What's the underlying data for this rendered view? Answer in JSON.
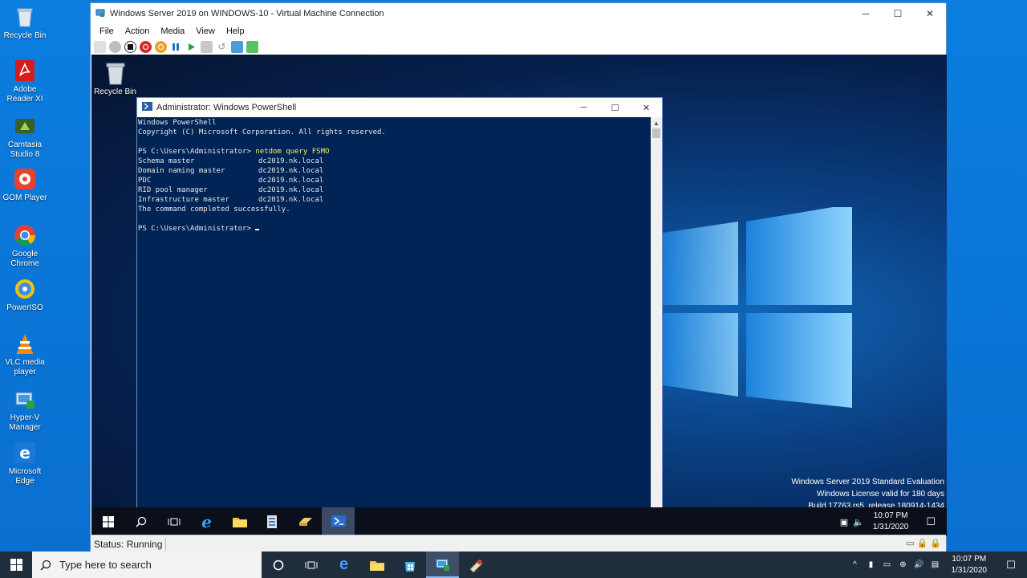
{
  "host_desktop": {
    "icons": [
      {
        "label": "Recycle Bin",
        "icon": "recycle-bin-icon"
      },
      {
        "label": "Adobe Reader XI",
        "icon": "adobe-reader-icon"
      },
      {
        "label": "Camtasia Studio 8",
        "icon": "camtasia-icon"
      },
      {
        "label": "GOM Player",
        "icon": "gom-player-icon"
      },
      {
        "label": "Google Chrome",
        "icon": "chrome-icon"
      },
      {
        "label": "PowerISO",
        "icon": "poweriso-icon"
      },
      {
        "label": "VLC media player",
        "icon": "vlc-icon"
      },
      {
        "label": "Hyper-V Manager",
        "icon": "hyper-v-icon"
      },
      {
        "label": "Microsoft Edge",
        "icon": "edge-icon"
      }
    ]
  },
  "vm_window": {
    "title": "Windows Server 2019 on WINDOWS-10 - Virtual Machine Connection",
    "menu": [
      "File",
      "Action",
      "Media",
      "View",
      "Help"
    ],
    "status": "Status: Running"
  },
  "guest": {
    "recycle_bin_label": "Recycle Bin",
    "watermark": {
      "line1": "Windows Server 2019 Standard Evaluation",
      "line2": "Windows License valid for 180 days",
      "line3": "Build 17763.rs5_release.180914-1434"
    },
    "clock": {
      "time": "10:07 PM",
      "date": "1/31/2020"
    }
  },
  "powershell": {
    "title": "Administrator: Windows PowerShell",
    "lines": {
      "header1": "Windows PowerShell",
      "header2": "Copyright (C) Microsoft Corporation. All rights reserved.",
      "prompt": "PS C:\\Users\\Administrator> ",
      "command": "netdom query FSMO",
      "roles": [
        {
          "role": "Schema master",
          "server": "dc2019.nk.local"
        },
        {
          "role": "Domain naming master",
          "server": "dc2019.nk.local"
        },
        {
          "role": "PDC",
          "server": "dc2019.nk.local"
        },
        {
          "role": "RID pool manager",
          "server": "dc2019.nk.local"
        },
        {
          "role": "Infrastructure master",
          "server": "dc2019.nk.local"
        }
      ],
      "result": "The command completed successfully."
    }
  },
  "host_taskbar": {
    "search_placeholder": "Type here to search",
    "clock": {
      "time": "10:07 PM",
      "date": "1/31/2020"
    }
  },
  "colors": {
    "ps_bg": "#012456",
    "command": "#f7f060",
    "host_bg": "#0a74d6"
  }
}
